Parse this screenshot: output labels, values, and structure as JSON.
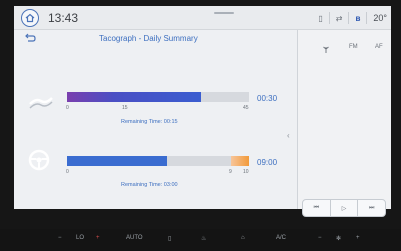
{
  "status_bar": {
    "time": "13:43",
    "temperature": "20°"
  },
  "screen": {
    "title": "Tacograph - Daily Summary",
    "rows": [
      {
        "icon": "road-icon",
        "progress_fraction": 0.75,
        "tick_labels": [
          "0",
          "15",
          "45"
        ],
        "time_value": "00:30",
        "remaining_label": "Remaining Time: 00:15",
        "fill_color": "#3a5dd0",
        "accent_color": "#7a3fae"
      },
      {
        "icon": "steering-wheel-icon",
        "progress_fraction": 0.55,
        "tick_labels": [
          "0",
          "9",
          "10"
        ],
        "time_value": "09:00",
        "remaining_label": "Remaining Time: 03:00",
        "fill_color": "#3a6cd0",
        "warning_color": "#f29a3a"
      }
    ]
  },
  "right_panel": {
    "tabs": [
      "FM",
      "AF"
    ],
    "media_controls": [
      "prev-icon",
      "play-icon",
      "next-icon"
    ]
  },
  "climate_bar": {
    "left_temp": "LO",
    "mode": "AUTO",
    "ac_label": "A/C"
  }
}
